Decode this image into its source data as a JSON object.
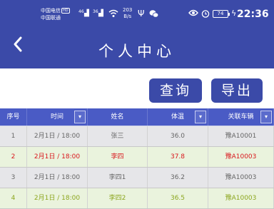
{
  "status_bar": {
    "carrier_1": "中国电信",
    "carrier_1_badge": "HD",
    "carrier_2": "中国联通",
    "signal_1": "46",
    "signal_2": "36",
    "net_speed_value": "203",
    "net_speed_unit": "B/s",
    "battery": "74",
    "time": "22:36"
  },
  "title_bar": {
    "title": "个人中心"
  },
  "actions": {
    "query": "查询",
    "export": "导出"
  },
  "table": {
    "columns": [
      {
        "label": "序号",
        "dropdown": false
      },
      {
        "label": "时间",
        "dropdown": true
      },
      {
        "label": "姓名",
        "dropdown": false
      },
      {
        "label": "体温",
        "dropdown": true
      },
      {
        "label": "关联车辆",
        "dropdown": true
      }
    ],
    "dropdown_glyph": "▾",
    "rows": [
      {
        "cells": [
          "1",
          "2月1日 / 18:00",
          "张三",
          "36.0",
          "豫A10001"
        ],
        "style": "normal"
      },
      {
        "cells": [
          "2",
          "2月1日 / 18:00",
          "李四",
          "37.8",
          "豫A10003"
        ],
        "style": "alert"
      },
      {
        "cells": [
          "3",
          "2月1日 / 18:00",
          "李四1",
          "36.2",
          "豫A10003"
        ],
        "style": "normal"
      },
      {
        "cells": [
          "4",
          "2月1日 / 18:00",
          "李四2",
          "36.5",
          "豫A10003"
        ],
        "style": "highlight"
      }
    ]
  },
  "colors": {
    "primary": "#3b4aa8",
    "header": "#4a5bc5",
    "row_gray": "#e6e6e9",
    "row_green": "#eaf3dd",
    "text_gray": "#666666",
    "text_red": "#d9161c",
    "text_olive": "#8ca61e"
  }
}
